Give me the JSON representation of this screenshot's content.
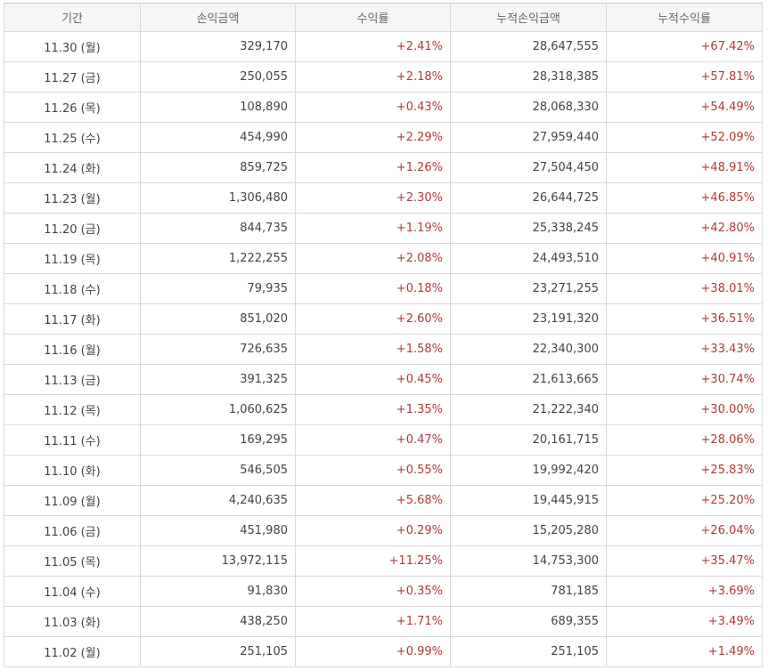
{
  "colors": {
    "positive": "#b23a3a",
    "header_bg": "#f6f6f6",
    "border": "#d9d9d9"
  },
  "headers": [
    "기간",
    "손익금액",
    "수익률",
    "누적손익금액",
    "누적수익률"
  ],
  "rows": [
    {
      "date": "11.30 (월)",
      "profit": "329,170",
      "rate": "+2.41%",
      "cum_profit": "28,647,555",
      "cum_rate": "+67.42%"
    },
    {
      "date": "11.27 (금)",
      "profit": "250,055",
      "rate": "+2.18%",
      "cum_profit": "28,318,385",
      "cum_rate": "+57.81%"
    },
    {
      "date": "11.26 (목)",
      "profit": "108,890",
      "rate": "+0.43%",
      "cum_profit": "28,068,330",
      "cum_rate": "+54.49%"
    },
    {
      "date": "11.25 (수)",
      "profit": "454,990",
      "rate": "+2.29%",
      "cum_profit": "27,959,440",
      "cum_rate": "+52.09%"
    },
    {
      "date": "11.24 (화)",
      "profit": "859,725",
      "rate": "+1.26%",
      "cum_profit": "27,504,450",
      "cum_rate": "+48.91%"
    },
    {
      "date": "11.23 (월)",
      "profit": "1,306,480",
      "rate": "+2.30%",
      "cum_profit": "26,644,725",
      "cum_rate": "+46.85%"
    },
    {
      "date": "11.20 (금)",
      "profit": "844,735",
      "rate": "+1.19%",
      "cum_profit": "25,338,245",
      "cum_rate": "+42.80%"
    },
    {
      "date": "11.19 (목)",
      "profit": "1,222,255",
      "rate": "+2.08%",
      "cum_profit": "24,493,510",
      "cum_rate": "+40.91%"
    },
    {
      "date": "11.18 (수)",
      "profit": "79,935",
      "rate": "+0.18%",
      "cum_profit": "23,271,255",
      "cum_rate": "+38.01%"
    },
    {
      "date": "11.17 (화)",
      "profit": "851,020",
      "rate": "+2.60%",
      "cum_profit": "23,191,320",
      "cum_rate": "+36.51%"
    },
    {
      "date": "11.16 (월)",
      "profit": "726,635",
      "rate": "+1.58%",
      "cum_profit": "22,340,300",
      "cum_rate": "+33.43%"
    },
    {
      "date": "11.13 (금)",
      "profit": "391,325",
      "rate": "+0.45%",
      "cum_profit": "21,613,665",
      "cum_rate": "+30.74%"
    },
    {
      "date": "11.12 (목)",
      "profit": "1,060,625",
      "rate": "+1.35%",
      "cum_profit": "21,222,340",
      "cum_rate": "+30.00%"
    },
    {
      "date": "11.11 (수)",
      "profit": "169,295",
      "rate": "+0.47%",
      "cum_profit": "20,161,715",
      "cum_rate": "+28.06%"
    },
    {
      "date": "11.10 (화)",
      "profit": "546,505",
      "rate": "+0.55%",
      "cum_profit": "19,992,420",
      "cum_rate": "+25.83%"
    },
    {
      "date": "11.09 (월)",
      "profit": "4,240,635",
      "rate": "+5.68%",
      "cum_profit": "19,445,915",
      "cum_rate": "+25.20%"
    },
    {
      "date": "11.06 (금)",
      "profit": "451,980",
      "rate": "+0.29%",
      "cum_profit": "15,205,280",
      "cum_rate": "+26.04%"
    },
    {
      "date": "11.05 (목)",
      "profit": "13,972,115",
      "rate": "+11.25%",
      "cum_profit": "14,753,300",
      "cum_rate": "+35.47%"
    },
    {
      "date": "11.04 (수)",
      "profit": "91,830",
      "rate": "+0.35%",
      "cum_profit": "781,185",
      "cum_rate": "+3.69%"
    },
    {
      "date": "11.03 (화)",
      "profit": "438,250",
      "rate": "+1.71%",
      "cum_profit": "689,355",
      "cum_rate": "+3.49%"
    },
    {
      "date": "11.02 (월)",
      "profit": "251,105",
      "rate": "+0.99%",
      "cum_profit": "251,105",
      "cum_rate": "+1.49%"
    }
  ]
}
